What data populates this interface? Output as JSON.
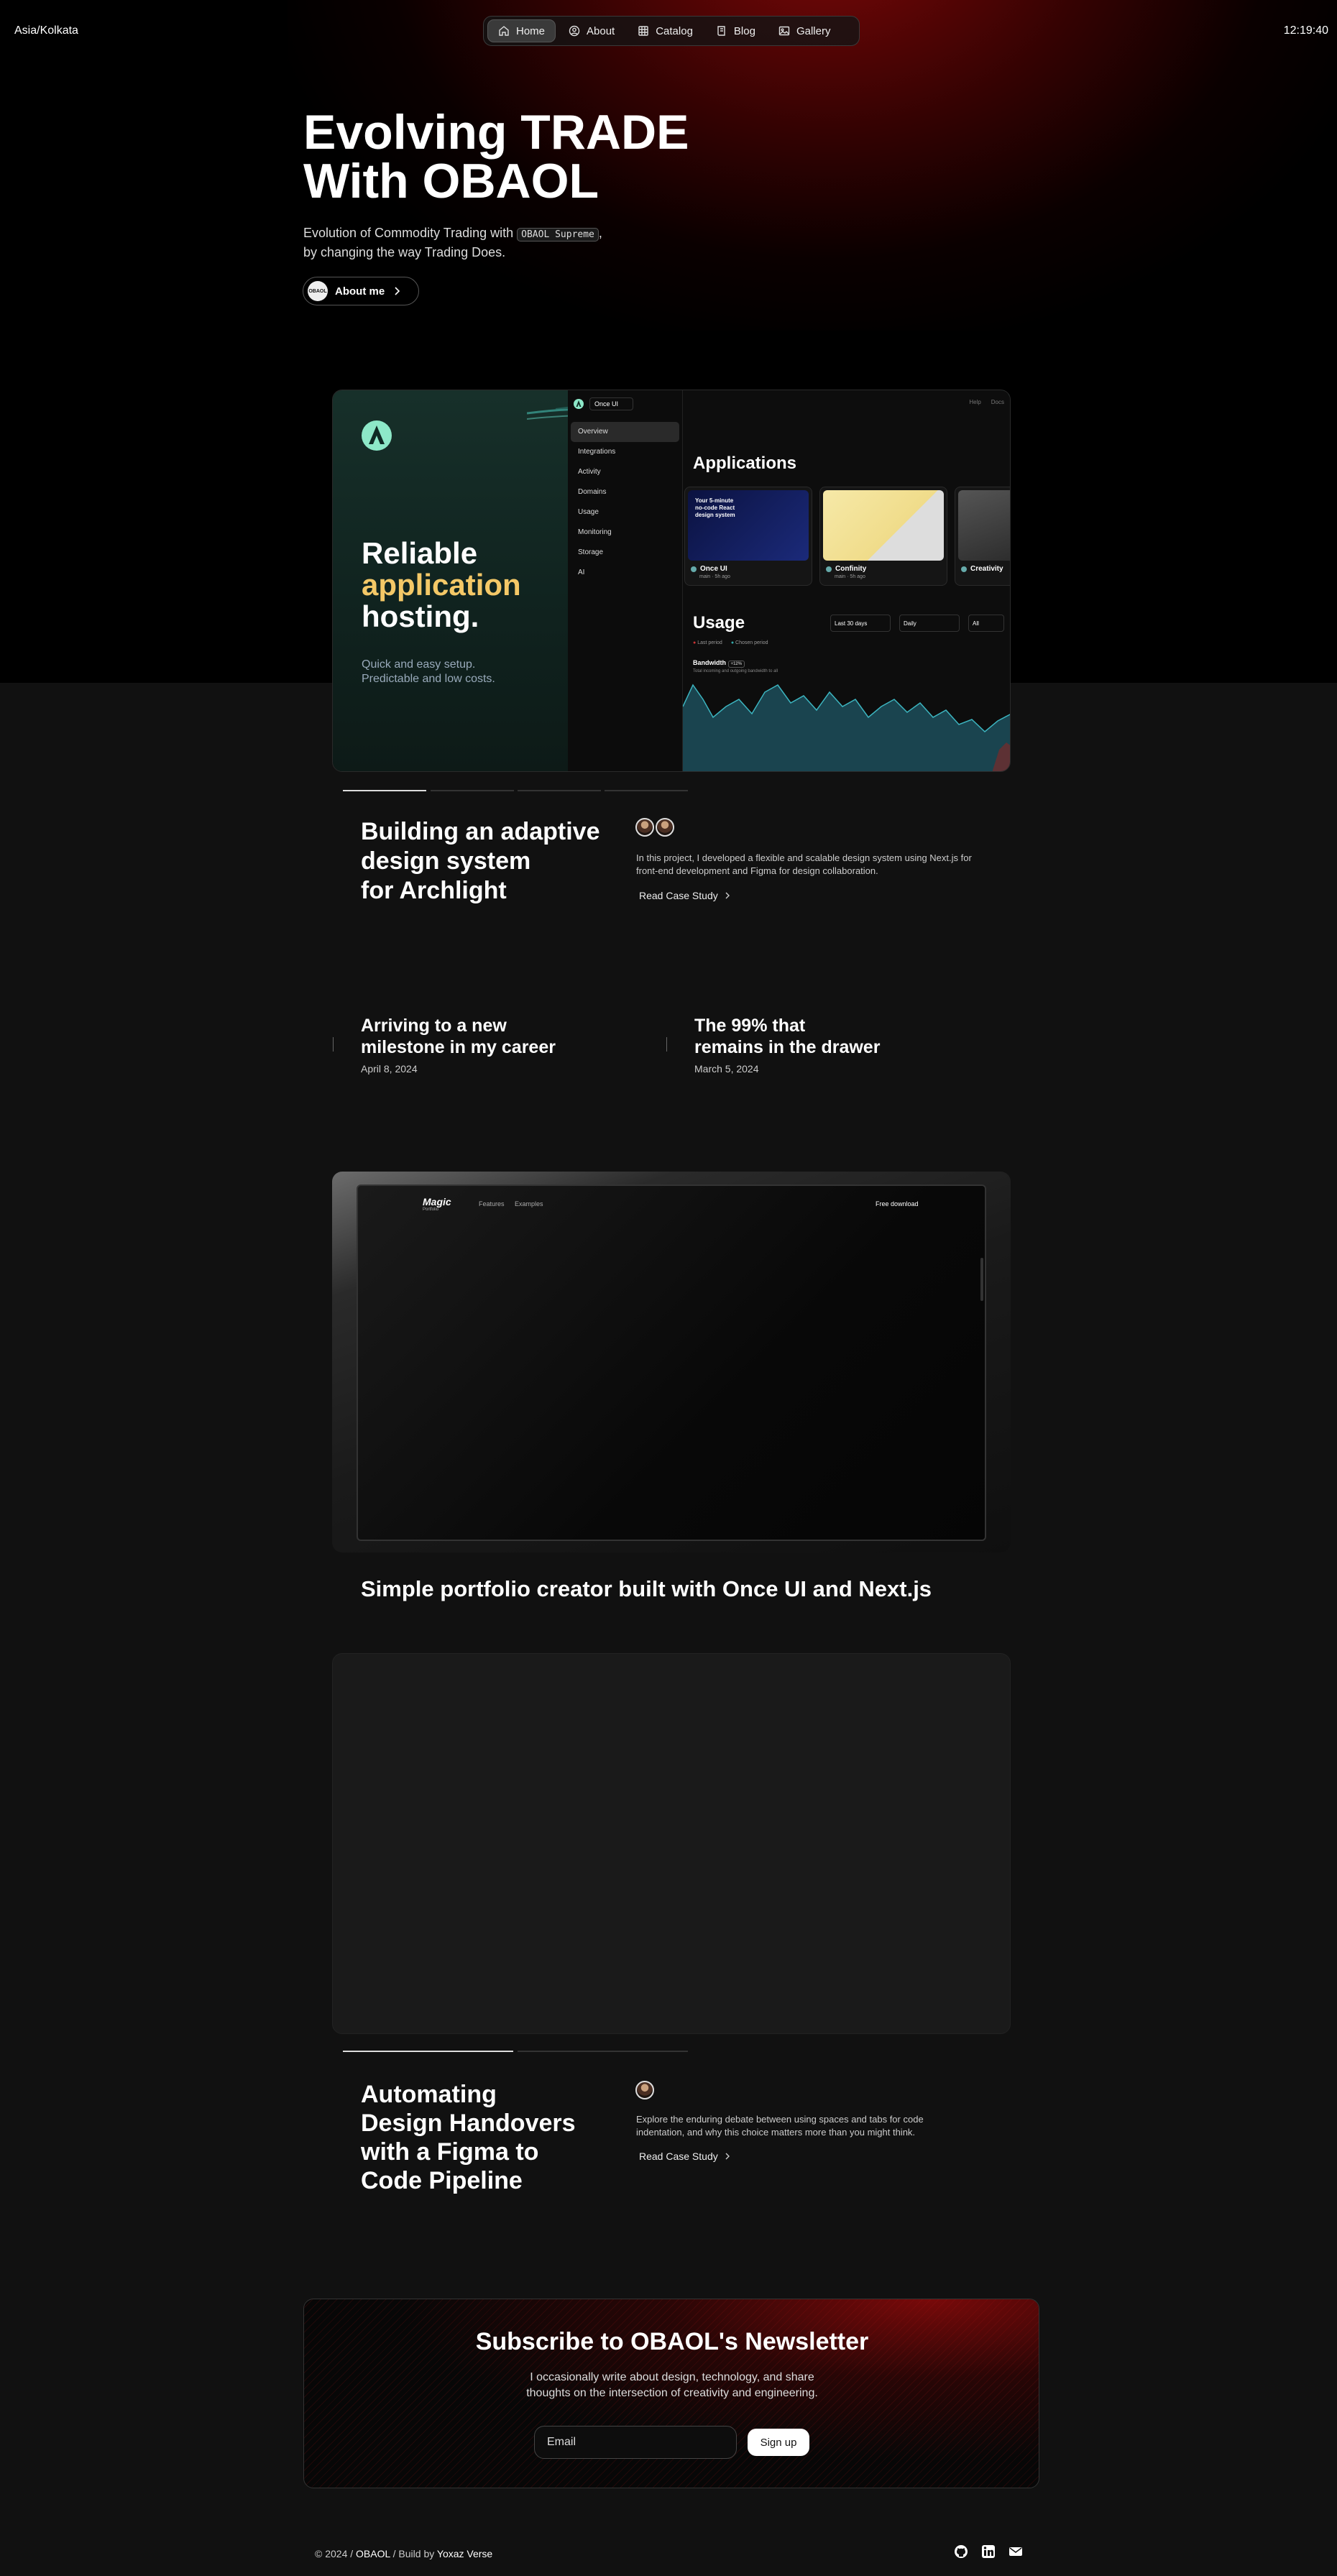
{
  "topbar": {
    "timezone": "Asia/Kolkata",
    "time": "12:19:40"
  },
  "nav": {
    "items": [
      {
        "label": "Home",
        "icon": "home-icon"
      },
      {
        "label": "About",
        "icon": "person-icon"
      },
      {
        "label": "Catalog",
        "icon": "grid-icon"
      },
      {
        "label": "Blog",
        "icon": "book-icon"
      },
      {
        "label": "Gallery",
        "icon": "image-icon"
      }
    ]
  },
  "hero": {
    "title_line1": "Evolving TRADE",
    "title_line2": "With OBAOL",
    "subtitle_before": "Evolution of Commodity Trading with ",
    "subtitle_code": "OBAOL Supreme",
    "subtitle_after": ",",
    "subtitle_line2": "by changing the way Trading Does.",
    "about_button": "About me",
    "avatar_text": "OBAOL"
  },
  "project_card": {
    "headline_1": "Reliable",
    "headline_2": "application",
    "headline_3": "hosting.",
    "sub_1": "Quick and easy setup.",
    "sub_2": "Predictable and low costs.",
    "mock": {
      "org": "Once UI",
      "top_links": [
        "Help",
        "Docs"
      ],
      "side_items": [
        "Overview",
        "Integrations",
        "Activity",
        "Domains",
        "Usage",
        "Monitoring",
        "Storage",
        "AI"
      ],
      "applications_title": "Applications",
      "apps": [
        "Once UI",
        "Confinity",
        "Creativity"
      ],
      "app_meta": [
        "main",
        "5h ago"
      ],
      "usage_title": "Usage",
      "legend": [
        "Last period",
        "Chosen period"
      ],
      "filters": [
        "Last 30 days",
        "Daily",
        "All"
      ],
      "bandwidth_label": "Bandwidth",
      "bandwidth_badge": "+12%",
      "bandwidth_sub": "Total incoming and outgoing bandwidth to all"
    }
  },
  "case1": {
    "title_1": "Building an adaptive",
    "title_2": "design system",
    "title_3": "for Archlight",
    "description": "In this project, I developed a flexible and scalable design system using Next.js for front-end development and Figma for design collaboration.",
    "read": "Read Case Study"
  },
  "blog": [
    {
      "title_1": "Arriving to a new",
      "title_2": "milestone in my career",
      "date": "April 8, 2024"
    },
    {
      "title_1": "The 99% that",
      "title_2": "remains in the drawer",
      "date": "March 5, 2024"
    }
  ],
  "case2": {
    "logo": "Magic",
    "logo_sub": "Portfolio",
    "links": [
      "Features",
      "Examples"
    ],
    "cta": "Free download",
    "title": "Simple portfolio creator built with Once UI and Next.js"
  },
  "case3": {
    "title_1": "Automating",
    "title_2": "Design Handovers",
    "title_3": "with a Figma to",
    "title_4": "Code Pipeline",
    "description_1": "Explore the enduring debate between using spaces and tabs for code",
    "description_2": "indentation, and why this choice matters more than you might think.",
    "read": "Read Case Study"
  },
  "newsletter": {
    "title": "Subscribe to OBAOL's Newsletter",
    "desc_1": "I occasionally write about design, technology, and share",
    "desc_2": "thoughts on the intersection of creativity and engineering.",
    "placeholder": "Email",
    "button": "Sign up"
  },
  "footer": {
    "copy": "© 2024 /",
    "brand": "OBAOL",
    "built": "/ Build by",
    "author": "Yoxaz Verse",
    "icons": [
      "github-icon",
      "linkedin-icon",
      "email-icon"
    ]
  },
  "colors": {
    "accent": "#f4c867",
    "brand_red": "#8a0a0a",
    "teal": "#2f8f89"
  }
}
